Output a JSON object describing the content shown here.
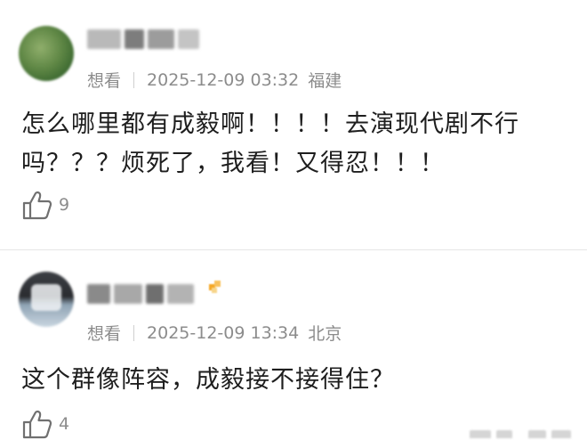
{
  "comments": [
    {
      "source": "想看",
      "datetime": "2025-12-09 03:32",
      "location": "福建",
      "text": "怎么哪里都有成毅啊！！！！去演现代剧不行吗？？？烦死了，我看！又得忍！！！",
      "likes": "9"
    },
    {
      "source": "想看",
      "datetime": "2025-12-09 13:34",
      "location": "北京",
      "text": "这个群像阵容，成毅接不接得住？",
      "likes": "4"
    }
  ],
  "icons": {
    "like": "thumbs-up-icon",
    "vip": "vip-badge-icon"
  },
  "colors": {
    "meta_text": "#8c8c8c",
    "body_text": "#1e1e1e",
    "badge": "#f5a623"
  }
}
